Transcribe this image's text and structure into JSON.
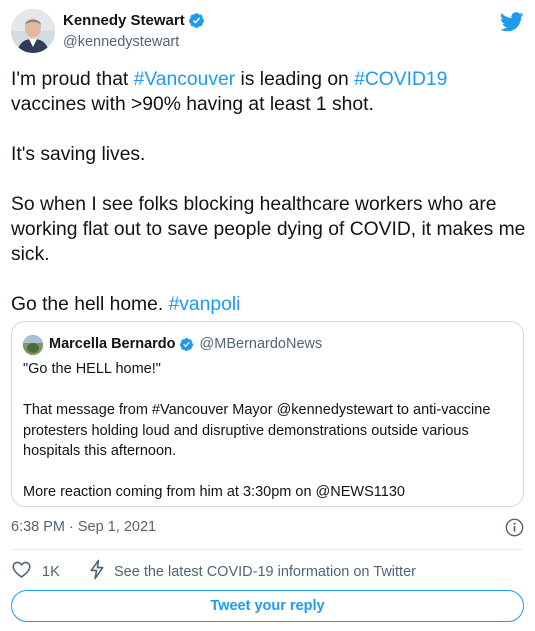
{
  "colors": {
    "accent": "#1d9bf0",
    "text_primary": "#0f1419",
    "text_secondary": "#536471",
    "border": "#cfd9de"
  },
  "author": {
    "name": "Kennedy Stewart",
    "handle": "@kennedystewart",
    "verified": true,
    "avatar_icon": "avatar-photo"
  },
  "tweet": {
    "paragraphs": [
      [
        {
          "text": "I'm proud that ",
          "type": "text"
        },
        {
          "text": "#Vancouver",
          "type": "hashtag"
        },
        {
          "text": " is leading on ",
          "type": "text"
        },
        {
          "text": "#COVID19",
          "type": "hashtag"
        },
        {
          "text": " vaccines with >90% having at least 1 shot.",
          "type": "text"
        }
      ],
      [
        {
          "text": "It's saving lives.",
          "type": "text"
        }
      ],
      [
        {
          "text": "So when I see folks blocking healthcare workers who are working flat out to save people dying of COVID, it makes me sick.",
          "type": "text"
        }
      ],
      [
        {
          "text": "Go the hell home. ",
          "type": "text"
        },
        {
          "text": "#vanpoli",
          "type": "hashtag"
        }
      ]
    ]
  },
  "quoted_tweet": {
    "name": "Marcella Bernardo",
    "handle": "@MBernardoNews",
    "verified": true,
    "paragraphs": [
      "\"Go the HELL home!\"",
      "That message from #Vancouver Mayor @kennedystewart to anti-vaccine protesters holding loud and disruptive demonstrations outside various hospitals this afternoon.",
      "More reaction coming from him at 3:30pm on @NEWS1130"
    ]
  },
  "meta": {
    "timestamp": "6:38 PM · Sep 1, 2021"
  },
  "actions": {
    "like_count": "1K",
    "covid_info": "See the latest COVID-19 information on Twitter",
    "reply_label": "Tweet your reply"
  },
  "icons": {
    "brand": "twitter-bird-icon",
    "verified": "verified-badge-icon",
    "info": "info-icon",
    "like": "heart-icon",
    "covid": "lightning-icon"
  }
}
